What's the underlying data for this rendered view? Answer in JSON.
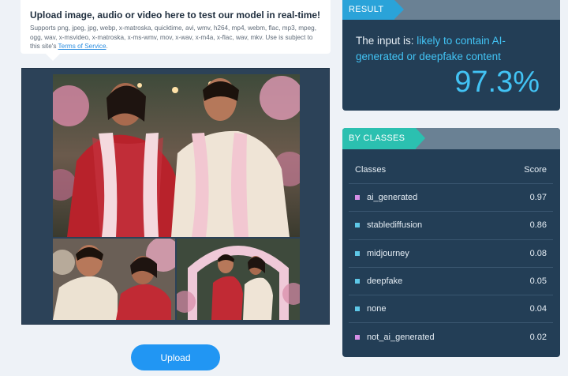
{
  "upload_info": {
    "title": "Upload image, audio or video here to test our model in real-time!",
    "supported_text": "Supports png, jpeg, jpg, webp, x-matroska, quicktime, avi, wmv, h264, mp4, webm, flac, mp3, mpeg, ogg, wav, x-msvideo, x-matroska, x-ms-wmv, mov, x-wav, x-m4a, x-flac, wav, mkv. Use is subject to this site's ",
    "terms_link": "Terms of Service",
    "terms_suffix": "."
  },
  "upload_button": {
    "label": "Upload"
  },
  "result": {
    "tag": "RESULT",
    "prefix": "The input is: ",
    "verdict": "likely to contain AI-generated or deepfake content",
    "score": "97.3%"
  },
  "classes": {
    "tag": "BY CLASSES",
    "header_class": "Classes",
    "header_score": "Score",
    "rows": [
      {
        "name": "ai_generated",
        "score": "0.97",
        "color": "#d58ee6"
      },
      {
        "name": "stablediffusion",
        "score": "0.86",
        "color": "#5ec8e8"
      },
      {
        "name": "midjourney",
        "score": "0.08",
        "color": "#5ec8e8"
      },
      {
        "name": "deepfake",
        "score": "0.05",
        "color": "#5ec8e8"
      },
      {
        "name": "none",
        "score": "0.04",
        "color": "#5ec8e8"
      },
      {
        "name": "not_ai_generated",
        "score": "0.02",
        "color": "#d58ee6"
      }
    ]
  },
  "colors": {
    "accent": "#42c3f4",
    "button": "#2196f3",
    "panel": "#233e56",
    "result_tag": "#2aa3d9",
    "classes_tag": "#2bc0b0"
  }
}
